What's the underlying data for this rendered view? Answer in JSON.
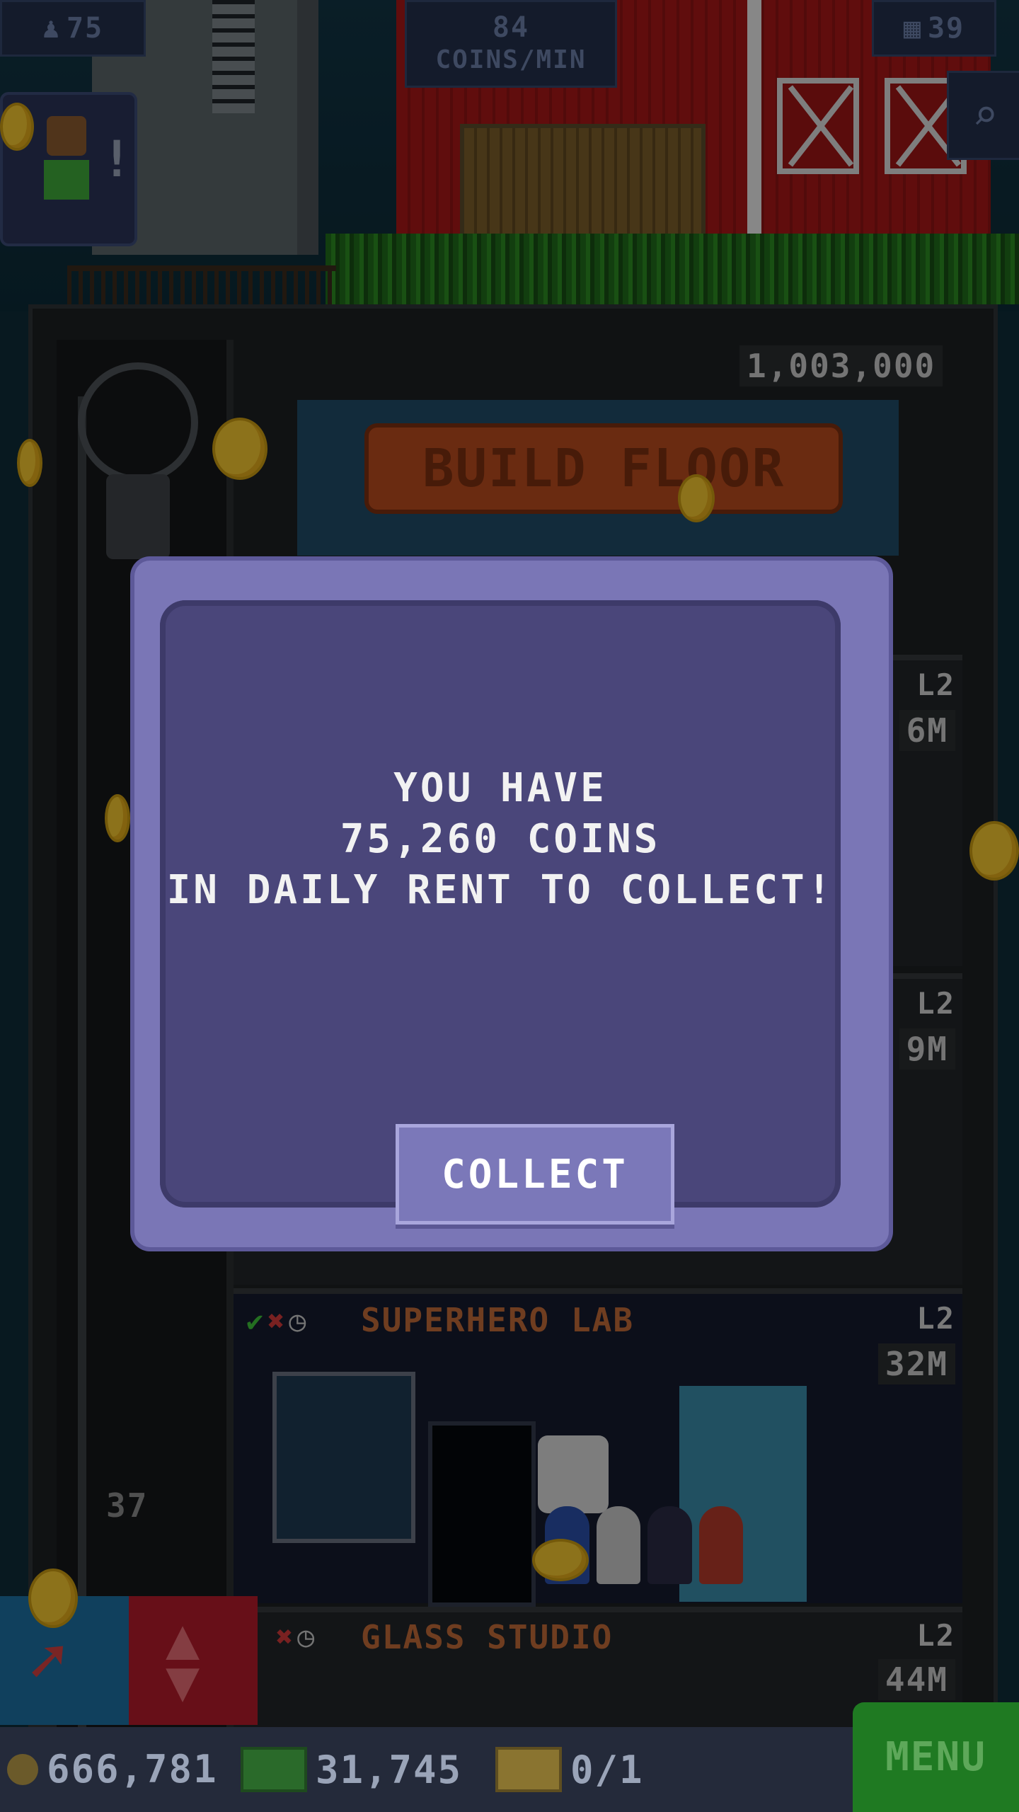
{
  "hud": {
    "population": "75",
    "coins_per_min_value": "84",
    "coins_per_min_label": "COINS/MIN",
    "floors": "39"
  },
  "tower": {
    "build_cost": "1,003,000",
    "build_label": "BUILD FLOOR",
    "floors": [
      {
        "level": "L2",
        "value": "6M"
      },
      {
        "level": "L2",
        "value": "9M"
      },
      {
        "name": "SUPERHERO LAB",
        "level": "L2",
        "value": "32M",
        "number": "37"
      },
      {
        "name": "GLASS STUDIO",
        "level": "L2",
        "value": "44M"
      }
    ]
  },
  "modal": {
    "line1": "YOU HAVE",
    "line2": "75,260 COINS",
    "line3": "IN DAILY RENT TO COLLECT!",
    "button_label": "COLLECT"
  },
  "bottom": {
    "coins": "666,781",
    "bux": "31,745",
    "tickets": "0/1",
    "menu_label": "MENU"
  },
  "colors": {
    "modal_frame": "#7a76b6",
    "modal_body": "#4a467a",
    "menu_green": "#1f7a22"
  }
}
